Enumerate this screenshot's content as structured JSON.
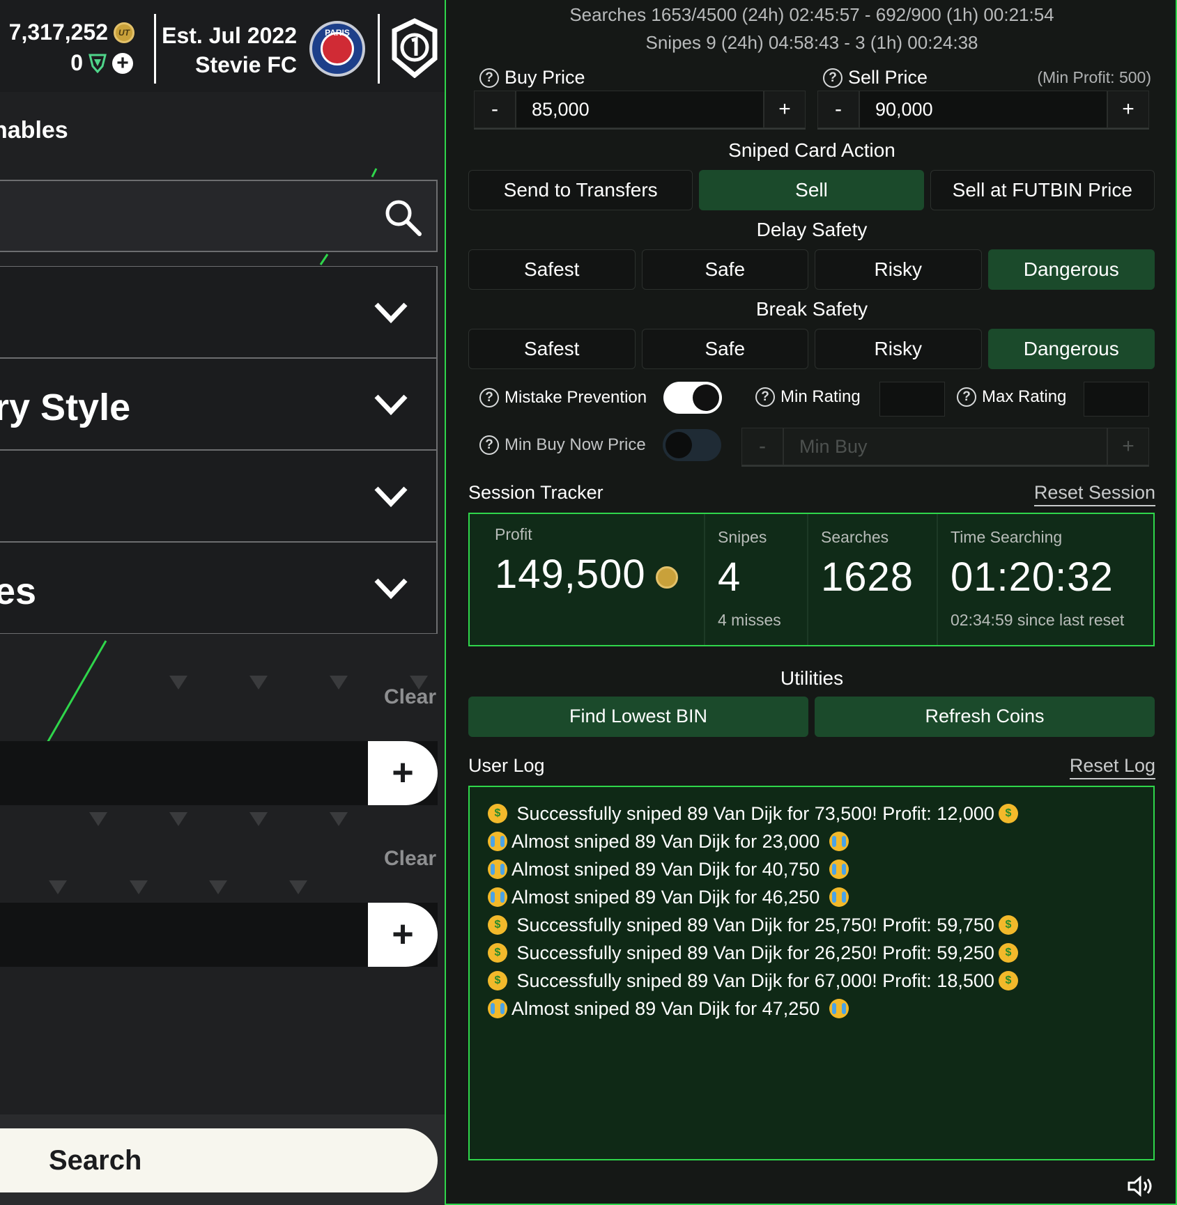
{
  "header": {
    "coins": "7,317,252",
    "coin_badge": "UT",
    "points": "0",
    "club_est": "Est. Jul 2022",
    "club_name": "Stevie FC",
    "crest_text": "PARIS"
  },
  "left": {
    "section_title": "nables",
    "dropdowns": [
      {
        "label": ""
      },
      {
        "label": "ry Style"
      },
      {
        "label": ""
      },
      {
        "label": "es"
      }
    ],
    "clear_label_1": "Clear",
    "clear_label_2": "Clear",
    "add_symbol": "+",
    "search_button": "Search"
  },
  "stats": {
    "searches_line": "Searches  1653/4500 (24h) 02:45:57  -  692/900 (1h) 00:21:54",
    "snipes_line": "Snipes  9 (24h) 04:58:43  -  3 (1h) 00:24:38"
  },
  "prices": {
    "buy_label": "Buy Price",
    "buy_value": "85,000",
    "sell_label": "Sell Price",
    "sell_value": "90,000",
    "min_profit": "(Min Profit: 500)",
    "minus": "-",
    "plus": "+"
  },
  "sniped_card_action": {
    "title": "Sniped Card Action",
    "options": [
      "Send to Transfers",
      "Sell",
      "Sell at FUTBIN Price"
    ],
    "selected": "Sell"
  },
  "delay_safety": {
    "title": "Delay Safety",
    "options": [
      "Safest",
      "Safe",
      "Risky",
      "Dangerous"
    ],
    "selected": "Dangerous"
  },
  "break_safety": {
    "title": "Break Safety",
    "options": [
      "Safest",
      "Safe",
      "Risky",
      "Dangerous"
    ],
    "selected": "Dangerous"
  },
  "filters": {
    "mistake_prevention": "Mistake Prevention",
    "mistake_prevention_on": true,
    "min_rating": "Min Rating",
    "max_rating": "Max Rating",
    "min_buy_now": "Min Buy Now Price",
    "min_buy_now_on": false,
    "min_buy_placeholder": "Min Buy"
  },
  "session": {
    "title": "Session Tracker",
    "reset": "Reset Session",
    "profit_label": "Profit",
    "profit_value": "149,500",
    "snipes_label": "Snipes",
    "snipes_value": "4",
    "misses": "4 misses",
    "searches_label": "Searches",
    "searches_value": "1628",
    "time_label": "Time Searching",
    "time_value": "01:20:32",
    "since_reset": "02:34:59 since last reset"
  },
  "utilities": {
    "title": "Utilities",
    "find_lowest": "Find Lowest BIN",
    "refresh_coins": "Refresh Coins"
  },
  "log": {
    "title": "User Log",
    "reset": "Reset Log",
    "entries": [
      {
        "type": "success",
        "text": " Successfully sniped 89 Van Dijk for 73,500! Profit: 12,000"
      },
      {
        "type": "miss",
        "text": "Almost sniped 89 Van Dijk for 23,000 "
      },
      {
        "type": "miss",
        "text": "Almost sniped 89 Van Dijk for 40,750 "
      },
      {
        "type": "miss",
        "text": "Almost sniped 89 Van Dijk for 46,250 "
      },
      {
        "type": "success",
        "text": " Successfully sniped 89 Van Dijk for 25,750! Profit: 59,750"
      },
      {
        "type": "success",
        "text": " Successfully sniped 89 Van Dijk for 26,250! Profit: 59,250"
      },
      {
        "type": "success",
        "text": " Successfully sniped 89 Van Dijk for 67,000! Profit: 18,500"
      },
      {
        "type": "miss",
        "text": "Almost sniped 89 Van Dijk for 47,250 "
      }
    ]
  },
  "colors": {
    "accent_green": "#2fd64b",
    "active_button": "#1b4a2b",
    "panel_bg": "#151816"
  },
  "icons": {
    "search": "search-icon",
    "chevron": "chevron-down-icon",
    "speaker": "speaker-icon"
  }
}
